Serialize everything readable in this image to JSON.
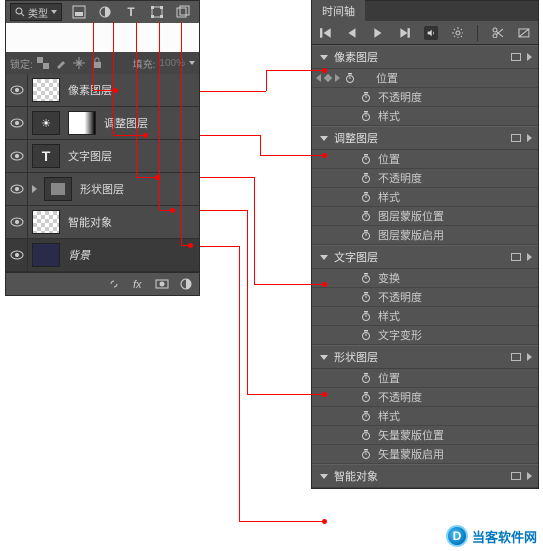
{
  "layers_panel": {
    "search_label": "类型",
    "lock_label": "锁定:",
    "fill_label": "填充:",
    "fill_value": "100%",
    "layers": [
      {
        "name": "像素图层"
      },
      {
        "name": "调整图层"
      },
      {
        "name": "文字图层"
      },
      {
        "name": "形状图层"
      },
      {
        "name": "智能对象"
      },
      {
        "name": "背景"
      }
    ]
  },
  "timeline_panel": {
    "tab": "时间轴",
    "groups": [
      {
        "name": "像素图层",
        "show_key_nav": true,
        "props": [
          "位置",
          "不透明度",
          "样式"
        ]
      },
      {
        "name": "调整图层",
        "props": [
          "位置",
          "不透明度",
          "样式",
          "图层蒙版位置",
          "图层蒙版启用"
        ]
      },
      {
        "name": "文字图层",
        "props": [
          "变换",
          "不透明度",
          "样式",
          "文字变形"
        ]
      },
      {
        "name": "形状图层",
        "props": [
          "位置",
          "不透明度",
          "样式",
          "矢量蒙版位置",
          "矢量蒙版启用"
        ]
      },
      {
        "name": "智能对象",
        "props": []
      }
    ]
  },
  "watermark": {
    "letter": "D",
    "text": "当客软件网"
  }
}
